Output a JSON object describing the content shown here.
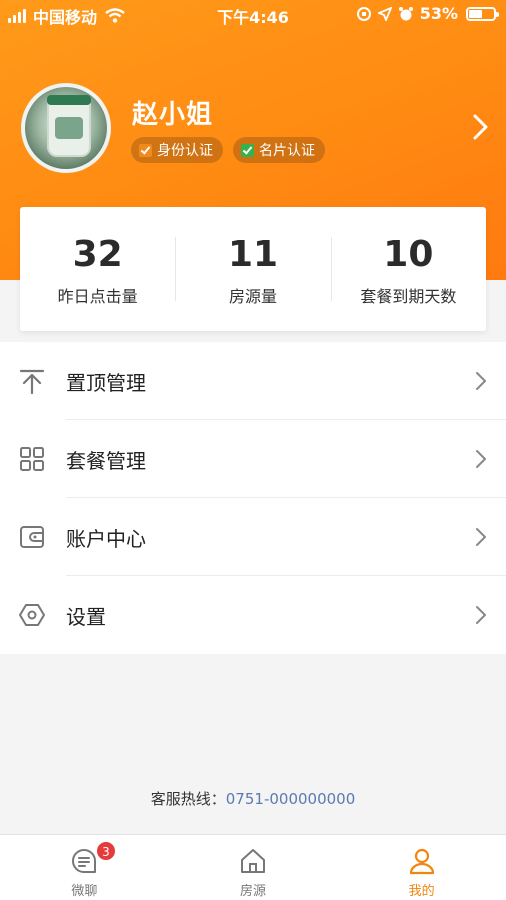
{
  "status_bar": {
    "carrier": "中国移动",
    "time": "下午4:46",
    "battery": "53%",
    "battery_level": 0.53
  },
  "profile": {
    "name": "赵小姐",
    "badges": [
      {
        "label": "身份认证",
        "color": "#f08a1c"
      },
      {
        "label": "名片认证",
        "color": "#36b24a"
      }
    ]
  },
  "stats": [
    {
      "value": "32",
      "label": "昨日点击量"
    },
    {
      "value": "11",
      "label": "房源量"
    },
    {
      "value": "10",
      "label": "套餐到期天数"
    }
  ],
  "menu": [
    {
      "label": "置顶管理",
      "icon": "pin-top-icon"
    },
    {
      "label": "套餐管理",
      "icon": "grid-icon"
    },
    {
      "label": "账户中心",
      "icon": "wallet-icon"
    },
    {
      "label": "设置",
      "icon": "settings-hexagon-icon"
    }
  ],
  "hotline": {
    "label": "客服热线：",
    "number": "0751-000000000"
  },
  "tabbar": {
    "tabs": [
      {
        "label": "微聊",
        "icon": "chat-icon",
        "badge": "3"
      },
      {
        "label": "房源",
        "icon": "home-icon"
      },
      {
        "label": "我的",
        "icon": "profile-icon",
        "active": true
      }
    ]
  },
  "colors": {
    "accent": "#ff8a12",
    "active_tab": "#f0860f",
    "badge_red": "#e63b3b"
  }
}
